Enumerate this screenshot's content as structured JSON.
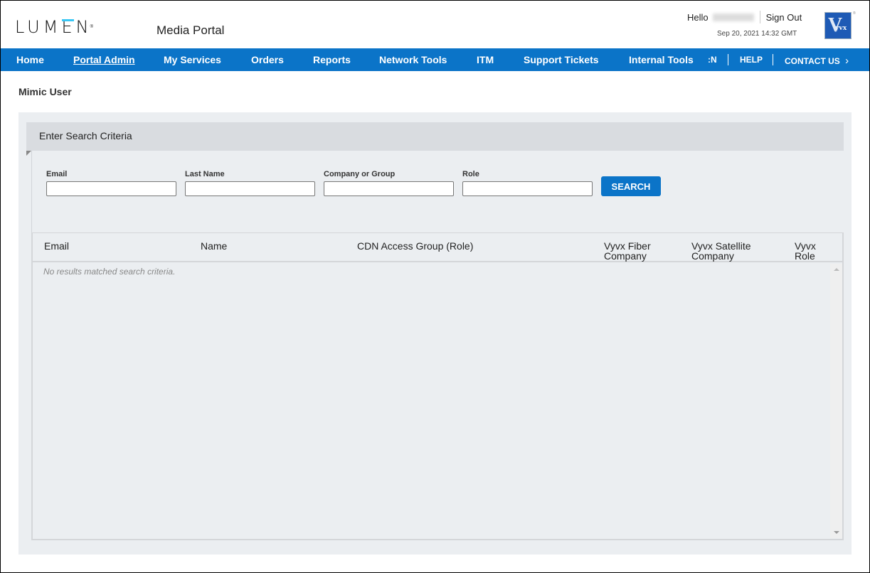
{
  "header": {
    "logo": {
      "pre": "LUM",
      "e": "E",
      "post": "N",
      "reg": "®"
    },
    "portal_title": "Media Portal",
    "hello": "Hello",
    "user_name_blurred": "",
    "sign_out": "Sign Out",
    "datetime": "Sep 20, 2021 14:32 GMT",
    "partner_logo": {
      "letter": "V",
      "text": "yvx"
    }
  },
  "nav": {
    "items": [
      {
        "label": "Home"
      },
      {
        "label": "Portal Admin",
        "active": true
      },
      {
        "label": "My Services"
      },
      {
        "label": "Orders"
      },
      {
        "label": "Reports"
      },
      {
        "label": "Network Tools"
      },
      {
        "label": "ITM"
      },
      {
        "label": "Support Tickets"
      },
      {
        "label": "Internal Tools"
      }
    ],
    "utility": [
      {
        "label": ":N"
      },
      {
        "label": "HELP"
      },
      {
        "label": "CONTACT US"
      }
    ],
    "chevron": "›",
    "accent_color": "#0b74c8"
  },
  "page": {
    "title": "Mimic User",
    "criteria_title": "Enter Search Criteria",
    "fields": [
      {
        "label": "Email",
        "value": "",
        "placeholder": ""
      },
      {
        "label": "Last Name",
        "value": "",
        "placeholder": ""
      },
      {
        "label": "Company or Group",
        "value": "",
        "placeholder": ""
      },
      {
        "label": "Role",
        "value": "",
        "placeholder": ""
      }
    ],
    "search_button": "SEARCH"
  },
  "table": {
    "columns": [
      {
        "line1": "Email",
        "line2": ""
      },
      {
        "line1": "Name",
        "line2": ""
      },
      {
        "line1": "CDN Access Group (Role)",
        "line2": ""
      },
      {
        "line1": "Vyvx Fiber",
        "line2": "Company"
      },
      {
        "line1": "Vyvx Satellite",
        "line2": "Company"
      },
      {
        "line1": "Vyvx",
        "line2": "Role"
      }
    ],
    "rows": [],
    "empty_message": "No results matched search criteria."
  }
}
